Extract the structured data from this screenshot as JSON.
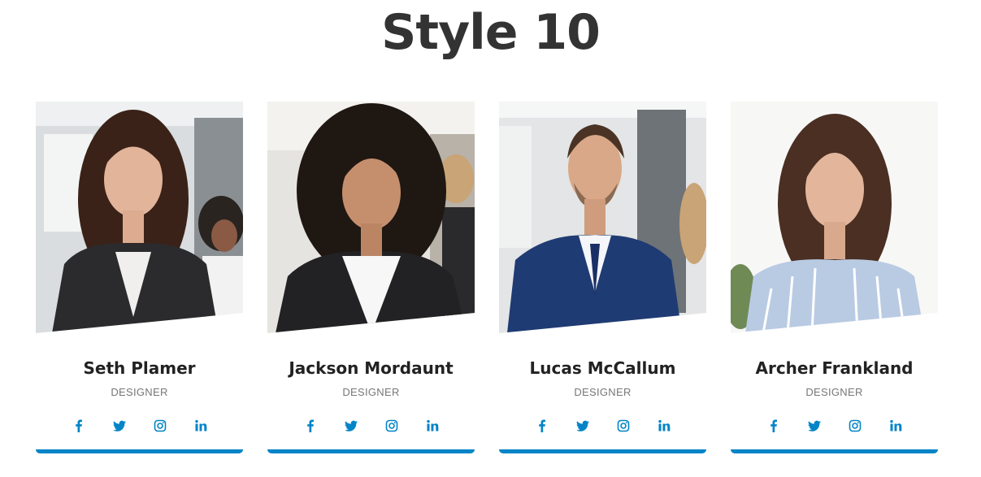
{
  "page": {
    "title": "Style 10"
  },
  "colors": {
    "accent": "#0284c7",
    "title": "#333333",
    "name": "#222222",
    "role": "#777777"
  },
  "members": [
    {
      "name": "Seth Plamer",
      "role": "DESIGNER"
    },
    {
      "name": "Jackson Mordaunt",
      "role": "DESIGNER"
    },
    {
      "name": "Lucas McCallum",
      "role": "DESIGNER"
    },
    {
      "name": "Archer Frankland",
      "role": "DESIGNER"
    }
  ],
  "social_icons": [
    "facebook-icon",
    "twitter-icon",
    "instagram-icon",
    "linkedin-icon"
  ]
}
